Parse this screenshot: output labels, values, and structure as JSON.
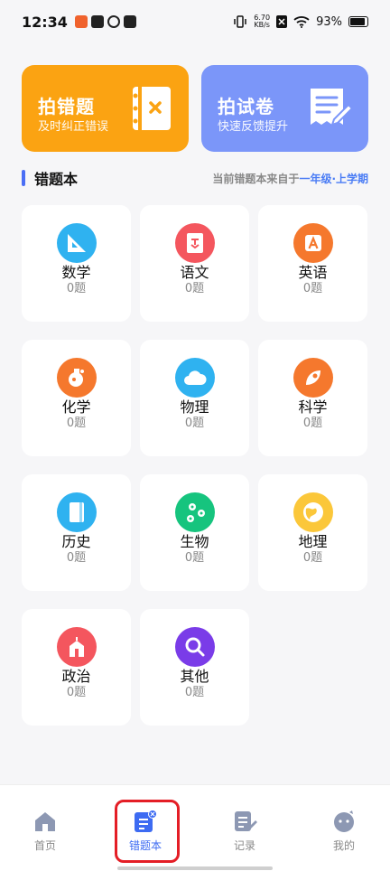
{
  "status_bar": {
    "time": "12:34",
    "net_speed_value": "6.70",
    "net_speed_unit": "KB/s",
    "battery": "93%"
  },
  "top_cards": {
    "photo_wrong": {
      "title": "拍错题",
      "subtitle": "及时纠正错误"
    },
    "photo_paper": {
      "title": "拍试卷",
      "subtitle": "快速反馈提升"
    }
  },
  "section": {
    "title": "错题本",
    "grade_prefix": "当前错题本来自于",
    "grade_value": "一年级·上学期"
  },
  "subjects": [
    {
      "name": "数学",
      "count": "0题"
    },
    {
      "name": "语文",
      "count": "0题"
    },
    {
      "name": "英语",
      "count": "0题"
    },
    {
      "name": "化学",
      "count": "0题"
    },
    {
      "name": "物理",
      "count": "0题"
    },
    {
      "name": "科学",
      "count": "0题"
    },
    {
      "name": "历史",
      "count": "0题"
    },
    {
      "name": "生物",
      "count": "0题"
    },
    {
      "name": "地理",
      "count": "0题"
    },
    {
      "name": "政治",
      "count": "0题"
    },
    {
      "name": "其他",
      "count": "0题"
    }
  ],
  "nav": {
    "home": "首页",
    "wrong_book": "错题本",
    "records": "记录",
    "mine": "我的"
  },
  "colors": {
    "accent": "#3d6bf2",
    "photo_wrong_card": "#fba312",
    "photo_paper_card": "#7b96f9",
    "highlight": "#e41e26"
  }
}
